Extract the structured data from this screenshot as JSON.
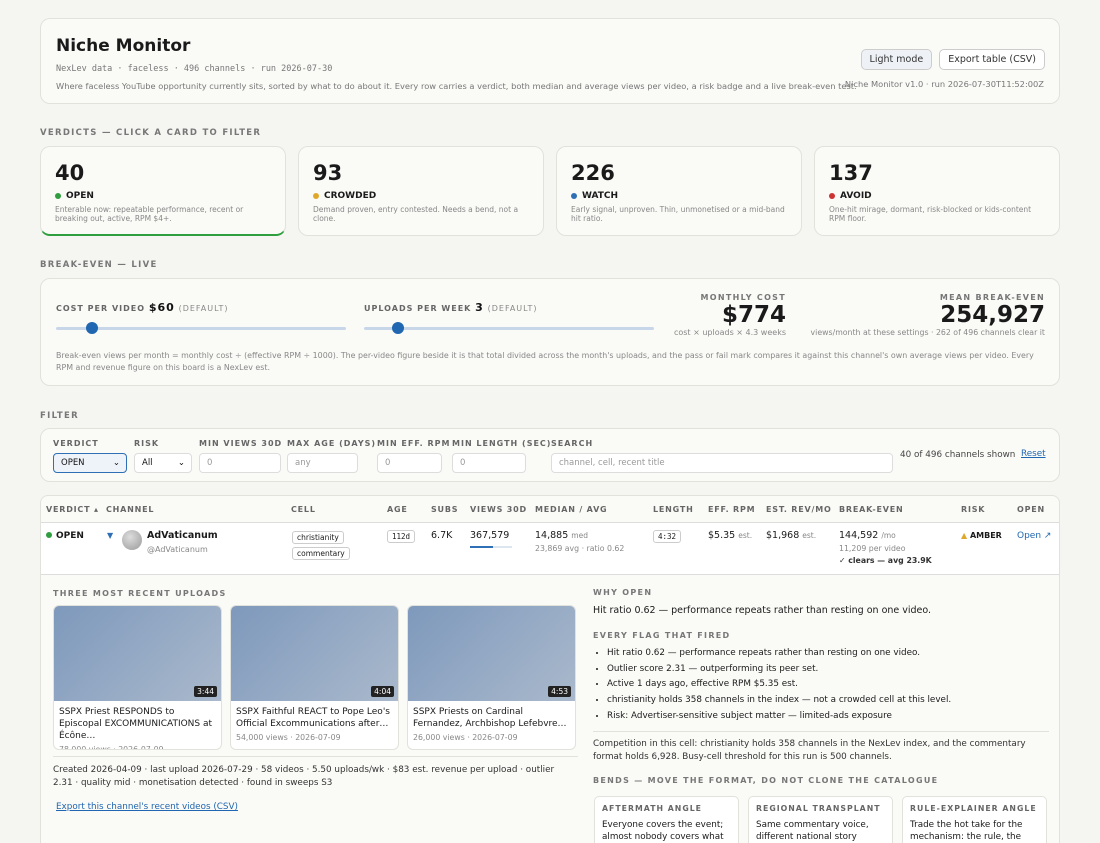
{
  "header": {
    "title": "Niche Monitor",
    "subtitle": "NexLev data · faceless · 496 channels · run 2026-07-30",
    "description": "Where faceless YouTube opportunity currently sits, sorted by what to do about it. Every row carries a verdict, both median and average views per video, a risk badge and a live break-even test.",
    "light_mode": "Light mode",
    "export": "Export table (CSV)",
    "version": "Niche Monitor v1.0 · run 2026-07-30T11:52:00Z"
  },
  "verdicts": {
    "label": "VERDICTS — CLICK A CARD TO FILTER",
    "cards": [
      {
        "num": "40",
        "tag": "OPEN",
        "color": "#2e9e3e",
        "desc": "Enterable now: repeatable performance, recent or breaking out, active, RPM $4+."
      },
      {
        "num": "93",
        "tag": "CROWDED",
        "color": "#e0a82a",
        "desc": "Demand proven, entry contested. Needs a bend, not a clone."
      },
      {
        "num": "226",
        "tag": "WATCH",
        "color": "#2f6fb5",
        "desc": "Early signal, unproven. Thin, unmonetised or a mid-band hit ratio."
      },
      {
        "num": "137",
        "tag": "AVOID",
        "color": "#cc3333",
        "desc": "One-hit mirage, dormant, risk-blocked or kids-content RPM floor."
      }
    ]
  },
  "breakeven": {
    "label": "BREAK-EVEN — LIVE",
    "cost_label": "COST PER VIDEO",
    "cost_value": "$60",
    "cost_default": "(DEFAULT)",
    "uploads_label": "UPLOADS PER WEEK",
    "uploads_value": "3",
    "uploads_default": "(DEFAULT)",
    "monthly_label": "MONTHLY COST",
    "monthly_value": "$774",
    "monthly_note": "cost × uploads × 4.3 weeks",
    "mean_label": "MEAN BREAK-EVEN",
    "mean_value": "254,927",
    "mean_note": "views/month at these settings · 262 of 496 channels clear it",
    "formula": "Break-even views per month = monthly cost ÷ (effective RPM ÷ 1000). The per-video figure beside it is that total divided across the month's uploads, and the pass or fail mark compares it against this channel's own average views per video. Every RPM and revenue figure on this board is a NexLev est."
  },
  "filter": {
    "label": "FILTER",
    "verdict_label": "VERDICT",
    "verdict_value": "OPEN",
    "risk_label": "RISK",
    "risk_value": "All",
    "minviews_label": "MIN VIEWS 30D",
    "minviews_ph": "0",
    "maxage_label": "MAX AGE (DAYS)",
    "maxage_ph": "any",
    "minrpm_label": "MIN EFF. RPM",
    "minrpm_ph": "0",
    "minlen_label": "MIN LENGTH (SEC)",
    "minlen_ph": "0",
    "search_label": "SEARCH",
    "search_ph": "channel, cell, recent title",
    "shown": "40 of 496 channels shown",
    "reset": "Reset"
  },
  "table": {
    "headers": [
      "VERDICT ▴",
      "CHANNEL",
      "CELL",
      "AGE",
      "SUBS",
      "VIEWS 30D",
      "MEDIAN / AVG",
      "LENGTH",
      "EFF. RPM",
      "EST. REV/MO",
      "BREAK-EVEN",
      "RISK",
      "OPEN"
    ],
    "row": {
      "verdict": "OPEN",
      "name": "AdVaticanum",
      "handle": "@AdVaticanum",
      "cells": [
        "christianity",
        "commentary"
      ],
      "age": "112d",
      "subs": "6.7K",
      "views": "367,579",
      "median": "14,885",
      "median_suffix": "med",
      "avg": "23,869 avg · ratio 0.62",
      "length": "4:32",
      "rpm": "$5.35",
      "rpm_suffix": "est.",
      "rev": "$1,968",
      "rev_suffix": "est.",
      "be": "144,592",
      "be_suffix": "/mo",
      "be_per": "11,209 per video",
      "be_pass": "✓ clears — avg 23.9K",
      "risk": "AMBER",
      "open": "Open ↗",
      "views_fraction": 0.55
    }
  },
  "detail": {
    "uploads_label": "THREE MOST RECENT UPLOADS",
    "uploads": [
      {
        "title": "SSPX Priest RESPONDS to Episcopal EXCOMMUNICATIONS at Écône…",
        "meta": "78,000 views · 2026-07-09",
        "dur": "3:44"
      },
      {
        "title": "SSPX Faithful REACT to Pope Leo's Official Excommunications after…",
        "meta": "54,000 views · 2026-07-09",
        "dur": "4:04"
      },
      {
        "title": "SSPX Priests on Cardinal Fernandez, Archbishop Lefebvre…",
        "meta": "26,000 views · 2026-07-09",
        "dur": "4:53"
      }
    ],
    "stats": "Created 2026-04-09 · last upload 2026-07-29 · 58 videos · 5.50 uploads/wk · $83 est. revenue per upload · outlier 2.31 · quality mid · monetisation detected · found in sweeps S3",
    "export_link": "Export this channel's recent videos (CSV)",
    "why_label": "WHY OPEN",
    "why": "Hit ratio 0.62 — performance repeats rather than resting on one video.",
    "flags_label": "EVERY FLAG THAT FIRED",
    "flags": [
      "Hit ratio 0.62 — performance repeats rather than resting on one video.",
      "Outlier score 2.31 — outperforming its peer set.",
      "Active 1 days ago, effective RPM $5.35 est.",
      "christianity holds 358 channels in the index — not a crowded cell at this level.",
      "Risk: Advertiser-sensitive subject matter — limited-ads exposure"
    ],
    "competition": "Competition in this cell: christianity holds 358 channels in the NexLev index, and the commentary format holds 6,928. Busy-cell threshold for this run is 500 channels.",
    "bends_label": "BENDS — MOVE THE FORMAT, DO NOT CLONE THE CATALOGUE",
    "bends": [
      {
        "h": "AFTERMATH ANGLE",
        "b": "Everyone covers the event; almost nobody covers what"
      },
      {
        "h": "REGIONAL TRANSPLANT",
        "b": "Same commentary voice, different national story"
      },
      {
        "h": "RULE-EXPLAINER ANGLE",
        "b": "Trade the hot take for the mechanism: the rule, the"
      }
    ]
  }
}
